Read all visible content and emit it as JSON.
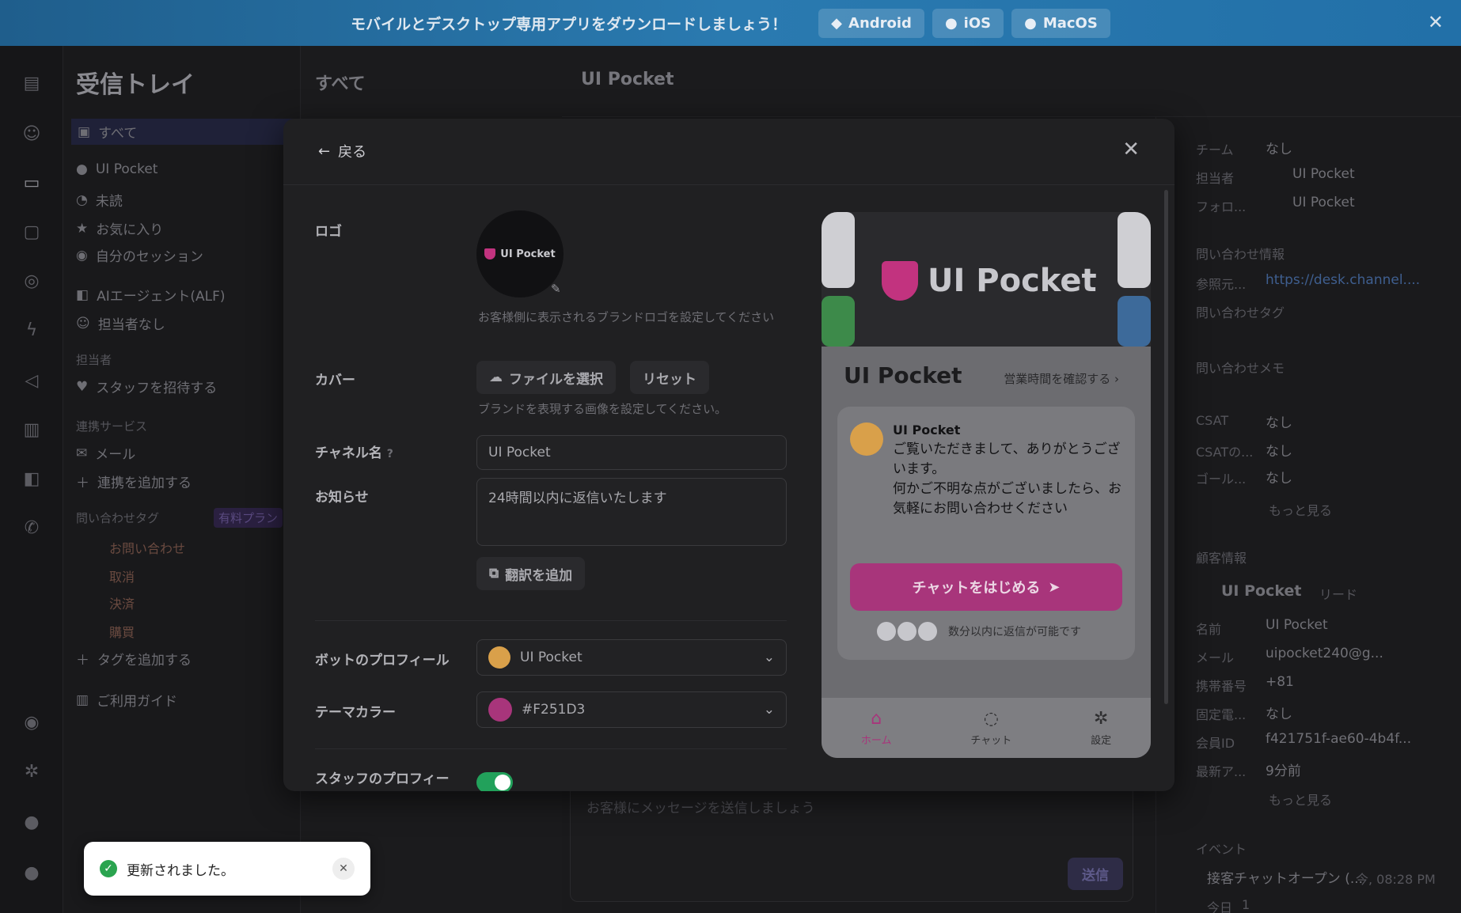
{
  "banner": {
    "message": "モバイルとデスクトップ専用アプリをダウンロードしましょう！",
    "android": "Android",
    "ios": "iOS",
    "macos": "MacOS"
  },
  "sidebar": {
    "title": "受信トレイ",
    "all": "すべて",
    "items": [
      "UI Pocket",
      "未読",
      "お気に入り",
      "自分のセッション",
      "AIエージェント(ALF)",
      "担当者なし"
    ],
    "assignee_section": "担当者",
    "invite_staff": "スタッフを招待する",
    "integration_section": "連携サービス",
    "mail": "メール",
    "add_integration": "連携を追加する",
    "tag_section": "問い合わせタグ",
    "paid_plan": "有料プラン",
    "tags": [
      "お問い合わせ",
      "取消",
      "決済",
      "購買"
    ],
    "add_tag": "タグを追加する",
    "guide": "ご利用ガイド"
  },
  "list": {
    "title": "すべて"
  },
  "conversation": {
    "title": "UI Pocket",
    "composer_placeholder": "お客様にメッセージを送信しましょう",
    "send": "送信"
  },
  "right_panel": {
    "team_label": "チーム",
    "team_value": "なし",
    "assignee_label": "担当者",
    "assignee_value": "UI Pocket",
    "follower_label": "フォロ...",
    "follower_value": "UI Pocket",
    "inquiry_info": "問い合わせ情報",
    "referrer_label": "参照元...",
    "referrer_value": "https://desk.channel....",
    "inquiry_tag": "問い合わせタグ",
    "inquiry_memo": "問い合わせメモ",
    "csat_label": "CSAT",
    "csat_value": "なし",
    "csat2_label": "CSATの...",
    "csat2_value": "なし",
    "goal_label": "ゴール...",
    "goal_value": "なし",
    "more": "もっと見る",
    "customer_info": "顧客情報",
    "customer_name": "UI Pocket",
    "customer_badge": "リード",
    "name_label": "名前",
    "name_value": "UI Pocket",
    "mail_label": "メール",
    "mail_value": "uipocket240@g...",
    "mobile_label": "携帯番号",
    "mobile_value": "+81",
    "phone_label": "固定電...",
    "phone_value": "なし",
    "member_label": "会員ID",
    "member_value": "f421751f-ae60-4b4f...",
    "recent_label": "最新ア...",
    "recent_value": "9分前",
    "more2": "もっと見る",
    "events": "イベント",
    "event_item": "接客チャットオープン (...",
    "event_time": "今, 08:28 PM",
    "today": "今日",
    "today_count": "1"
  },
  "modal": {
    "back": "戻る",
    "logo_label": "ロゴ",
    "logo_text": "UI Pocket",
    "logo_hint": "お客様側に表示されるブランドロゴを設定してください",
    "cover_label": "カバー",
    "choose_file": "ファイルを選択",
    "reset": "リセット",
    "cover_hint": "ブランドを表現する画像を設定してください。",
    "channel_name_label": "チャネル名",
    "channel_name_value": "UI Pocket",
    "notice_label": "お知らせ",
    "notice_value": "24時間以内に返信いたします",
    "add_translation": "翻訳を追加",
    "bot_profile_label": "ボットのプロフィール",
    "bot_profile_value": "UI Pocket",
    "theme_color_label": "テーマカラー",
    "theme_color_value": "#F251D3",
    "staff_profile_label": "スタッフのプロフィー"
  },
  "preview": {
    "cover_brand": "UI Pocket",
    "name": "UI Pocket",
    "hours_link": "営業時間を確認する",
    "sender": "UI Pocket",
    "greeting": "ご覧いただきまして、ありがとうございます。\n何かご不明な点がございましたら、お気軽にお問い合わせください",
    "start_chat": "チャットをはじめる",
    "response_time": "数分以内に返信が可能です",
    "tab_home": "ホーム",
    "tab_chat": "チャット",
    "tab_settings": "設定"
  },
  "toast": {
    "message": "更新されました。"
  },
  "colors": {
    "theme": "#F251D3",
    "toggle": "#22a15b",
    "success": "#2aa44f"
  }
}
